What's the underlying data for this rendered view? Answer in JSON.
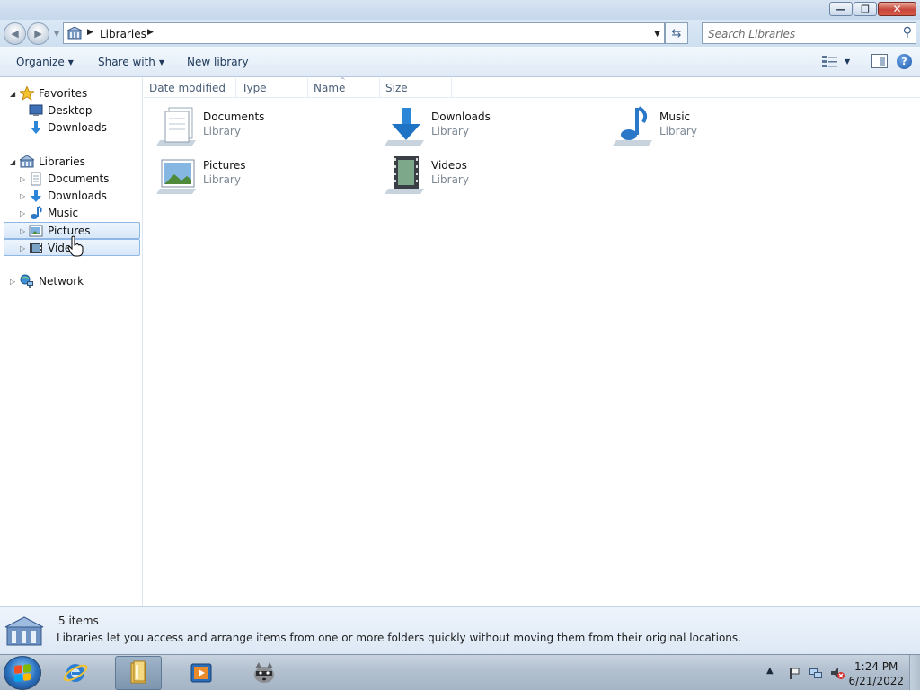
{
  "window": {
    "caption": {
      "minimize": "—",
      "maximize": "❐",
      "close": "✕"
    }
  },
  "address_bar": {
    "breadcrumb": "Libraries",
    "search_placeholder": "Search Libraries"
  },
  "command_bar": {
    "organize": "Organize",
    "share_with": "Share with",
    "new_library": "New library"
  },
  "nav_pane": {
    "favorites": {
      "label": "Favorites",
      "items": [
        "Desktop",
        "Downloads"
      ]
    },
    "libraries": {
      "label": "Libraries",
      "items": [
        "Documents",
        "Downloads",
        "Music",
        "Pictures",
        "Vide"
      ]
    },
    "network": {
      "label": "Network"
    }
  },
  "columns": [
    "Date modified",
    "Type",
    "Name",
    "Size"
  ],
  "items": [
    {
      "name": "Documents",
      "type": "Library"
    },
    {
      "name": "Downloads",
      "type": "Library"
    },
    {
      "name": "Music",
      "type": "Library"
    },
    {
      "name": "Pictures",
      "type": "Library"
    },
    {
      "name": "Videos",
      "type": "Library"
    }
  ],
  "details": {
    "count": "5 items",
    "description": "Libraries let you access and arrange items from one or more folders quickly without moving them from their original locations."
  },
  "taskbar": {
    "time": "1:24 PM",
    "date": "6/21/2022"
  },
  "colors": {
    "accent": "#1e395b",
    "selection": "#d7e7f9",
    "close_button": "#c7463a"
  }
}
